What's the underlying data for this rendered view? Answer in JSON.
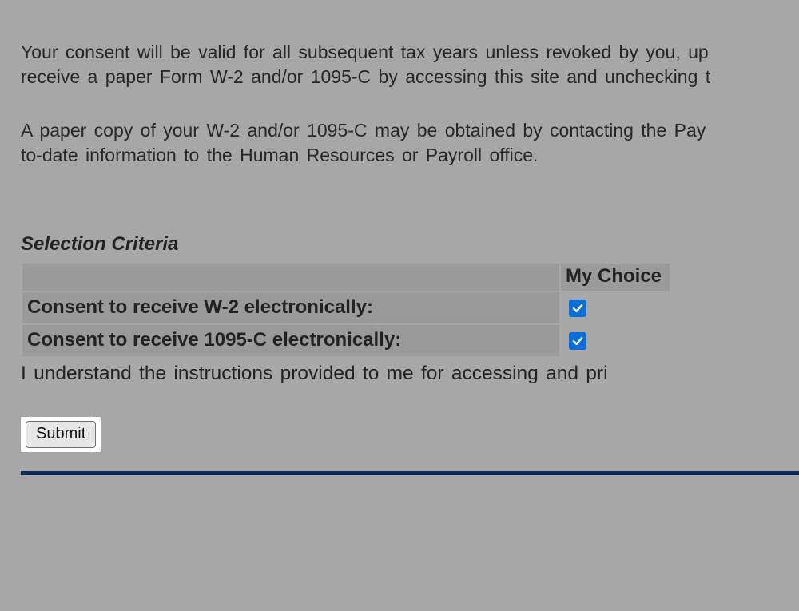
{
  "paragraphs": {
    "p1_line1": "Your consent will be valid for all subsequent tax years unless revoked by you, up",
    "p1_line2": "receive a paper Form W-2 and/or 1095-C by accessing this site and unchecking t",
    "p2_line1": "A paper copy of your W-2 and/or 1095-C may be obtained by contacting the Pay",
    "p2_line2": "to-date information to the Human Resources or Payroll office."
  },
  "section_heading": "Selection Criteria",
  "table": {
    "header_choice": "My Choice",
    "rows": [
      {
        "label": "Consent to receive W-2 electronically:",
        "checked": true
      },
      {
        "label": "Consent to receive 1095-C electronically:",
        "checked": true
      }
    ]
  },
  "understand_text": "I understand the instructions provided to me for accessing and pri",
  "submit_label": "Submit"
}
